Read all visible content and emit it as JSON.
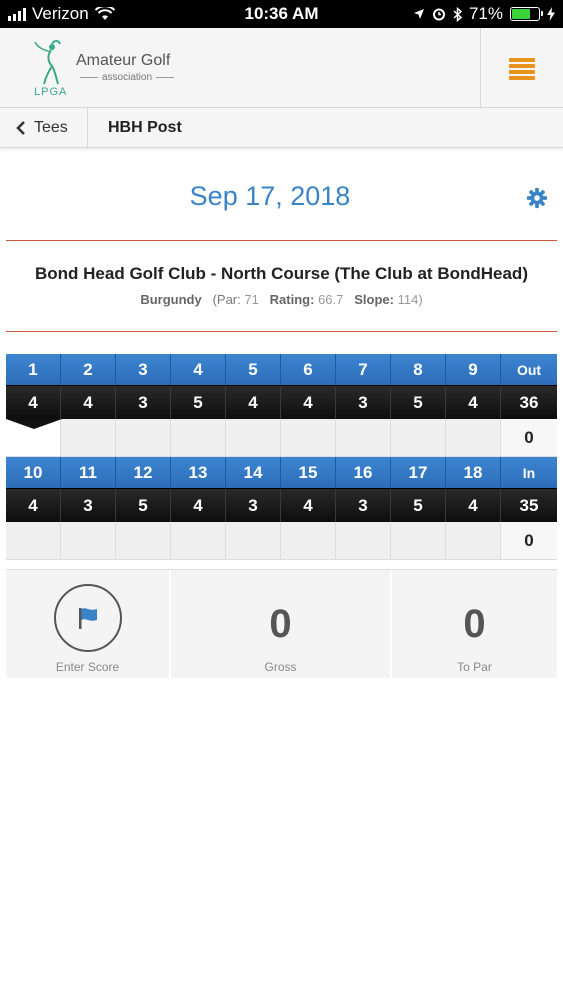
{
  "status_bar": {
    "carrier": "Verizon",
    "time": "10:36 AM",
    "battery_percent": "71%",
    "battery_level": 0.71
  },
  "header": {
    "logo_title": "Amateur Golf",
    "logo_subtitle": "association",
    "logo_mark": "LPGA",
    "accent_color": "#e8931a"
  },
  "subnav": {
    "back_label": "Tees",
    "title": "HBH Post"
  },
  "round": {
    "date": "Sep 17, 2018"
  },
  "course": {
    "name": "Bond Head Golf Club - North Course (The Club at BondHead)",
    "tee": "Burgundy",
    "par_label": "(Par:",
    "par_value": "71",
    "rating_label": "Rating:",
    "rating_value": "66.7",
    "slope_label": "Slope:",
    "slope_value": "114)"
  },
  "scorecard": {
    "front": {
      "holes": [
        "1",
        "2",
        "3",
        "4",
        "5",
        "6",
        "7",
        "8",
        "9"
      ],
      "pars": [
        "4",
        "4",
        "3",
        "5",
        "4",
        "4",
        "3",
        "5",
        "4"
      ],
      "total_label": "Out",
      "total_par": "36",
      "total_score": "0"
    },
    "back": {
      "holes": [
        "10",
        "11",
        "12",
        "13",
        "14",
        "15",
        "16",
        "17",
        "18"
      ],
      "pars": [
        "4",
        "3",
        "5",
        "4",
        "3",
        "4",
        "3",
        "5",
        "4"
      ],
      "total_label": "In",
      "total_par": "35",
      "total_score": "0"
    }
  },
  "summary": {
    "enter_score_label": "Enter Score",
    "gross_value": "0",
    "gross_label": "Gross",
    "to_par_value": "0",
    "to_par_label": "To Par"
  },
  "colors": {
    "primary_blue": "#3b83c7",
    "rule_red": "#c9573a"
  }
}
